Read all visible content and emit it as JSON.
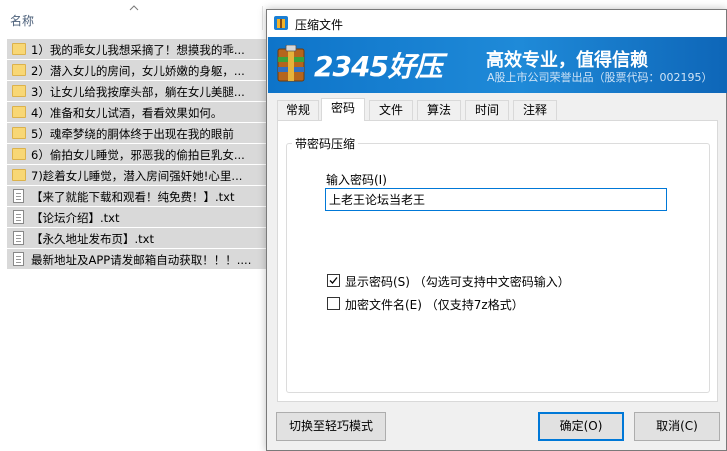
{
  "explorer": {
    "column_name": "名称",
    "files": [
      {
        "type": "folder",
        "name": "1）我的乖女儿我想采摘了！想摸我的乖..."
      },
      {
        "type": "folder",
        "name": "2）潜入女儿的房间，女儿娇嫩的身躯，..."
      },
      {
        "type": "folder",
        "name": "3）让女儿给我按摩头部，躺在女儿美腿..."
      },
      {
        "type": "folder",
        "name": "4）准备和女儿试酒，看看效果如何。"
      },
      {
        "type": "folder",
        "name": "5）魂牵梦绕的胴体终于出现在我的眼前"
      },
      {
        "type": "folder",
        "name": "6）偷拍女儿睡觉，邪恶我的偷拍巨乳女..."
      },
      {
        "type": "folder",
        "name": "7)趁着女儿睡觉，潜入房间强奸她!心里..."
      },
      {
        "type": "file",
        "name": "【来了就能下载和观看！纯免费！】.txt"
      },
      {
        "type": "file",
        "name": "【论坛介绍】.txt"
      },
      {
        "type": "file",
        "name": "【永久地址发布页】.txt"
      },
      {
        "type": "file",
        "name": "最新地址及APP请发邮箱自动获取！！！...."
      }
    ]
  },
  "dialog": {
    "title": "压缩文件",
    "banner": {
      "brand": "2345好压",
      "slogan": "高效专业，值得信赖",
      "sub": "A股上市公司荣誉出品（股票代码：002195）",
      "colors": {
        "bg": "#1580d0",
        "text": "#ffffff"
      }
    },
    "tabs": [
      {
        "label": "常规",
        "active": false
      },
      {
        "label": "密码",
        "active": true
      },
      {
        "label": "文件",
        "active": false
      },
      {
        "label": "算法",
        "active": false
      },
      {
        "label": "时间",
        "active": false
      },
      {
        "label": "注释",
        "active": false
      }
    ],
    "group_title": "带密码压缩",
    "password_label": "输入密码(I)",
    "password_value": "上老王论坛当老王",
    "show_password": {
      "label": "显示密码(S) （勾选可支持中文密码输入）",
      "checked": true
    },
    "encrypt_names": {
      "label": "加密文件名(E) （仅支持7z格式）",
      "checked": false
    },
    "buttons": {
      "light_mode": "切换至轻巧模式",
      "ok": "确定(O)",
      "cancel": "取消(C)"
    },
    "accent_color": "#0078d7"
  }
}
